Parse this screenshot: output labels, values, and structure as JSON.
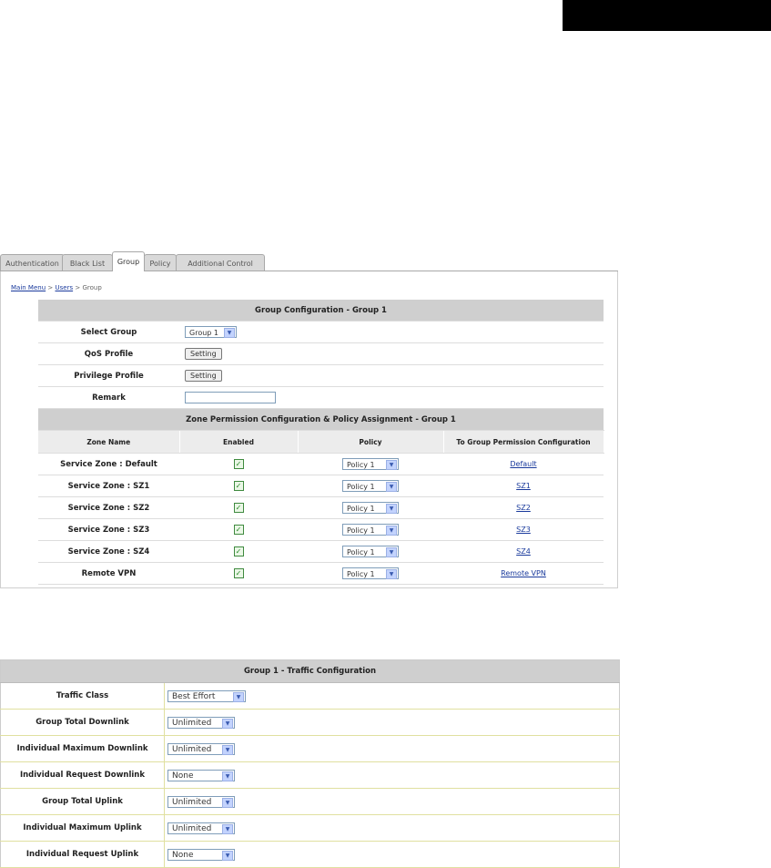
{
  "tabs": [
    "Authentication",
    "Black List",
    "Group",
    "Policy",
    "Additional Control"
  ],
  "active_tab": "Group",
  "breadcrumb": {
    "main_menu": "Main Menu",
    "sep1": ">",
    "users": "Users",
    "sep2": ">",
    "current": "Group"
  },
  "group_config": {
    "title": "Group Configuration - Group 1",
    "select_group_label": "Select Group",
    "select_group_value": "Group 1",
    "qos_label": "QoS Profile",
    "privilege_label": "Privilege Profile",
    "setting_label": "Setting",
    "remark_label": "Remark",
    "remark_value": ""
  },
  "zone_permission": {
    "title": "Zone Permission Configuration & Policy Assignment - Group 1",
    "columns": [
      "Zone Name",
      "Enabled",
      "Policy",
      "To Group Permission Configuration"
    ],
    "rows": [
      {
        "zone": "Service Zone : Default",
        "enabled": true,
        "policy": "Policy 1",
        "link": "Default"
      },
      {
        "zone": "Service Zone : SZ1",
        "enabled": true,
        "policy": "Policy 1",
        "link": "SZ1"
      },
      {
        "zone": "Service Zone : SZ2",
        "enabled": true,
        "policy": "Policy 1",
        "link": "SZ2"
      },
      {
        "zone": "Service Zone : SZ3",
        "enabled": true,
        "policy": "Policy 1",
        "link": "SZ3"
      },
      {
        "zone": "Service Zone : SZ4",
        "enabled": true,
        "policy": "Policy 1",
        "link": "SZ4"
      },
      {
        "zone": "Remote VPN",
        "enabled": true,
        "policy": "Policy 1",
        "link": "Remote VPN"
      }
    ]
  },
  "traffic_config": {
    "title": "Group 1 - Traffic Configuration",
    "rows": [
      {
        "label": "Traffic Class",
        "value": "Best Effort"
      },
      {
        "label": "Group Total Downlink",
        "value": "Unlimited"
      },
      {
        "label": "Individual Maximum Downlink",
        "value": "Unlimited"
      },
      {
        "label": "Individual Request Downlink",
        "value": "None"
      },
      {
        "label": "Group Total Uplink",
        "value": "Unlimited"
      },
      {
        "label": "Individual Maximum Uplink",
        "value": "Unlimited"
      },
      {
        "label": "Individual Request Uplink",
        "value": "None"
      }
    ]
  },
  "icons": {
    "dropdown_arrow": "▼",
    "checkmark": "✓"
  }
}
